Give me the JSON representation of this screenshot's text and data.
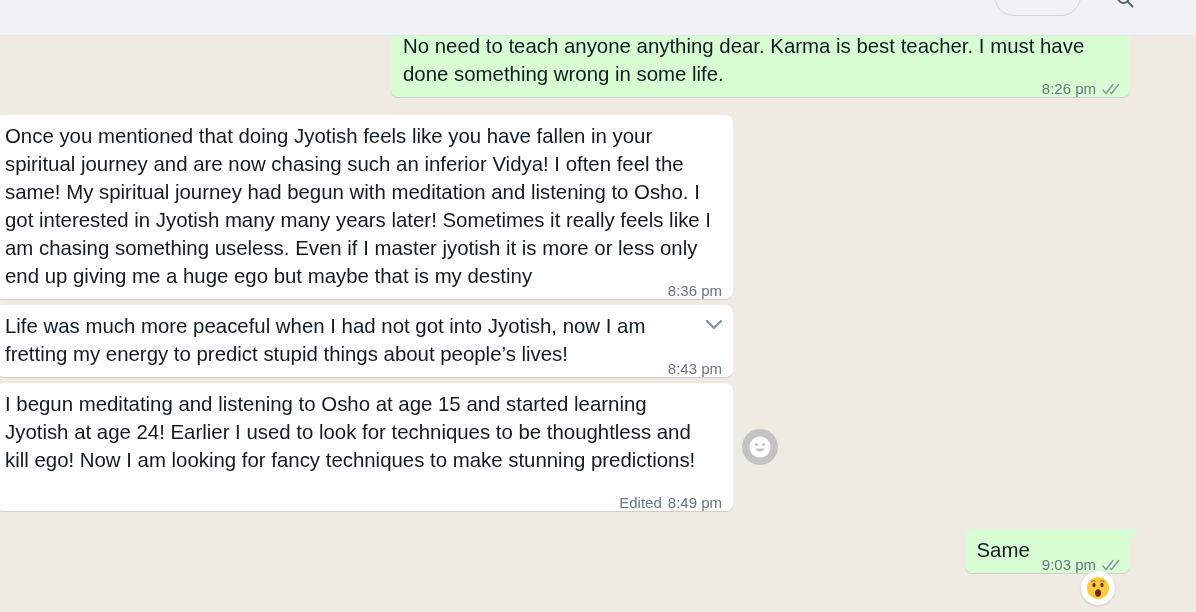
{
  "messages": [
    {
      "outgoing": true,
      "text": "No need to teach anyone anything dear. Karma is best teacher. I must have done something wrong in some life.",
      "time": "8:26 pm",
      "read": false,
      "tail": false,
      "menu_button": false,
      "react_button": false,
      "reaction": false
    },
    {
      "outgoing": false,
      "text": "Once you mentioned that doing Jyotish feels like you have fallen in your spiritual journey and are now chasing such an inferior Vidya! I often feel the same! My spiritual journey had begun with meditation and listening to Osho. I got interested in Jyotish many many years later! Sometimes it really feels like I am chasing something useless. Even if I master jyotish it is more or less only end up giving me a huge ego but maybe that is my destiny",
      "time": "8:36 pm",
      "tail": false,
      "menu_button": false,
      "react_button": false,
      "reaction": false
    },
    {
      "outgoing": false,
      "text": "Life was much more peaceful when I had not got into Jyotish, now I am fretting my energy to predict stupid things about people’s lives!",
      "time": "8:43 pm",
      "tail": false,
      "menu_button": true,
      "react_button": false,
      "reaction": false
    },
    {
      "outgoing": false,
      "text": "I begun meditating and listening to Osho at age 15 and started learning Jyotish at age 24! Earlier I used to look for techniques to be thoughtless and kill ego! Now I am looking for fancy techniques to make stunning predictions!",
      "edited_label": "Edited",
      "time": "8:49 pm",
      "tail": false,
      "menu_button": false,
      "react_button": true,
      "reaction": false
    },
    {
      "outgoing": true,
      "text": "Same",
      "time": "9:03 pm",
      "read": false,
      "tail": true,
      "menu_button": false,
      "react_button": false,
      "reaction": true
    }
  ]
}
